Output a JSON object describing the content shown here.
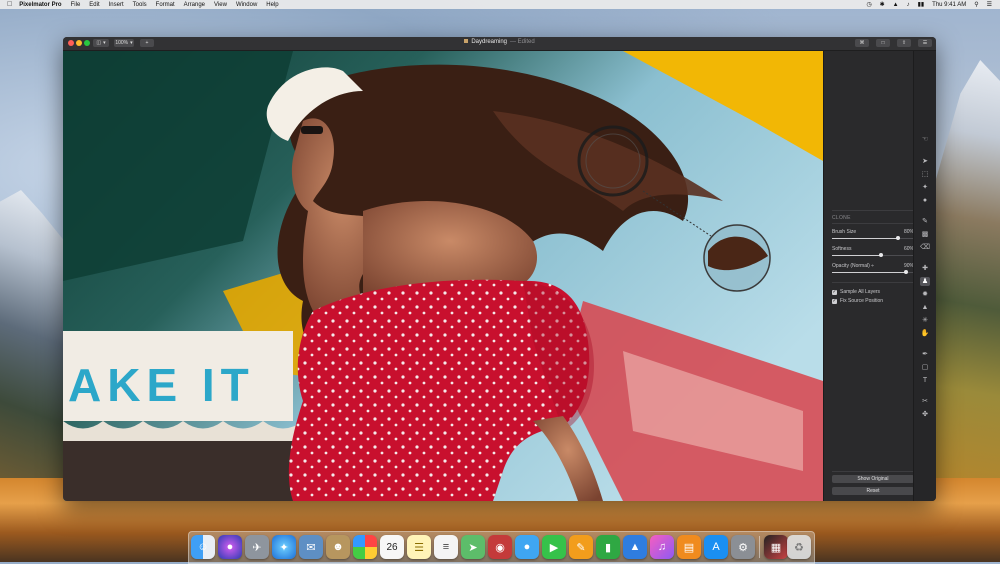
{
  "menubar": {
    "app_name": "Pixelmator Pro",
    "items": [
      "File",
      "Edit",
      "Insert",
      "Tools",
      "Format",
      "Arrange",
      "View",
      "Window",
      "Help"
    ],
    "clock": "Thu 9:41 AM"
  },
  "window": {
    "zoom_label": "100%",
    "document_title": "Daydreaming",
    "document_status": "— Edited"
  },
  "canvas": {
    "sign_text": "AKE IT"
  },
  "panel": {
    "section_title": "CLONE",
    "sliders": [
      {
        "label": "Brush Size",
        "value": "80%",
        "level": 0.8
      },
      {
        "label": "Softness",
        "value": "60%",
        "level": 0.6
      },
      {
        "label": "Opacity (Normal) ÷",
        "value": "90%",
        "level": 0.9
      }
    ],
    "checkboxes": [
      {
        "label": "Sample All Layers",
        "checked": true
      },
      {
        "label": "Fix Source Position",
        "checked": true
      }
    ],
    "show_original_label": "Show Original",
    "reset_label": "Reset"
  },
  "colors": {
    "dress_red": "#c8102e",
    "panel_bg": "#2a2a2c",
    "accent_yellow": "#f2b705"
  },
  "dock": {
    "icon_names": [
      "finder-icon",
      "siri-icon",
      "launchpad-icon",
      "safari-icon",
      "mail-stamp-icon",
      "contacts-icon",
      "photos-icon",
      "calendar-icon",
      "notes-icon",
      "reminders-icon",
      "maps-icon",
      "photo-booth-icon",
      "messages-icon",
      "facetime-icon",
      "pages-icon",
      "numbers-icon",
      "keynote-icon",
      "itunes-icon",
      "ibooks-icon",
      "app-store-icon",
      "system-preferences-icon",
      "pixelmator-icon",
      "trash-icon"
    ],
    "calendar_day": "26"
  }
}
